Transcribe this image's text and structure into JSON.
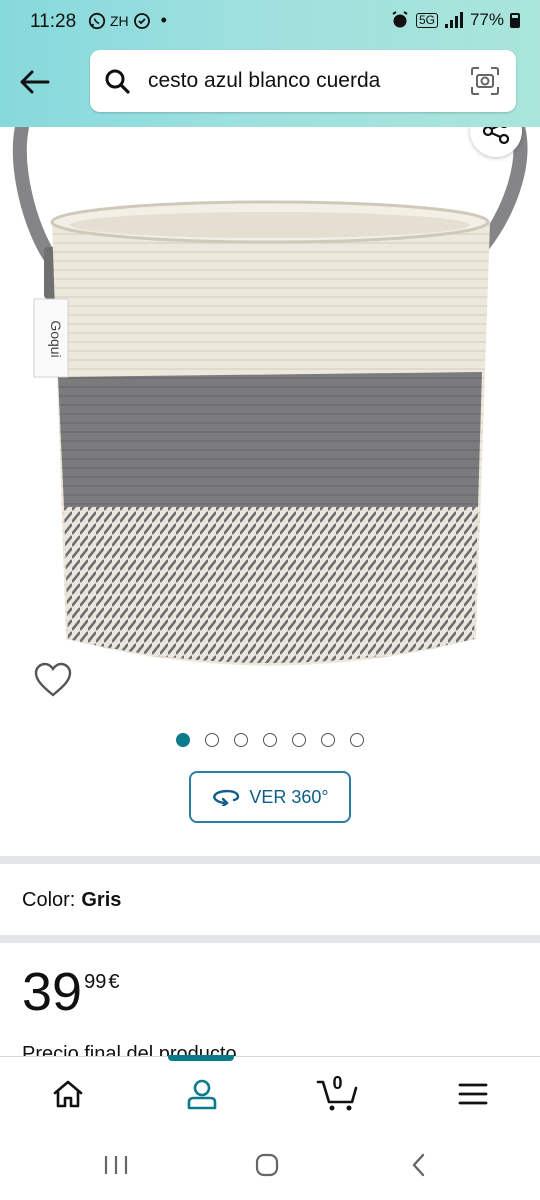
{
  "status_bar": {
    "time": "11:28",
    "left_label": "ZH",
    "network": "5G",
    "battery": "77%"
  },
  "search": {
    "query": "cesto azul blanco cuerda",
    "icons": [
      "back-arrow-icon",
      "search-icon",
      "camera-icon"
    ]
  },
  "product": {
    "tag_text": "Goqui",
    "carousel": {
      "total": 7,
      "active_index": 0
    },
    "ver360_label": "VER 360°",
    "color_label": "Color:",
    "color_value": "Gris",
    "price_whole": "39",
    "price_fraction": "99",
    "price_currency": "€",
    "price_note": "Precio final del producto"
  },
  "bottom_nav": {
    "items": [
      "home-icon",
      "account-icon",
      "cart-icon",
      "menu-icon"
    ],
    "active": "account-icon",
    "cart_count": "0"
  },
  "android_nav": [
    "recents-icon",
    "home-circle-icon",
    "back-chevron-icon"
  ],
  "colors": {
    "header_start": "#86d9dc",
    "header_end": "#a9e5da",
    "accent": "#0a7b8b",
    "link_blue": "#0f5e88"
  }
}
